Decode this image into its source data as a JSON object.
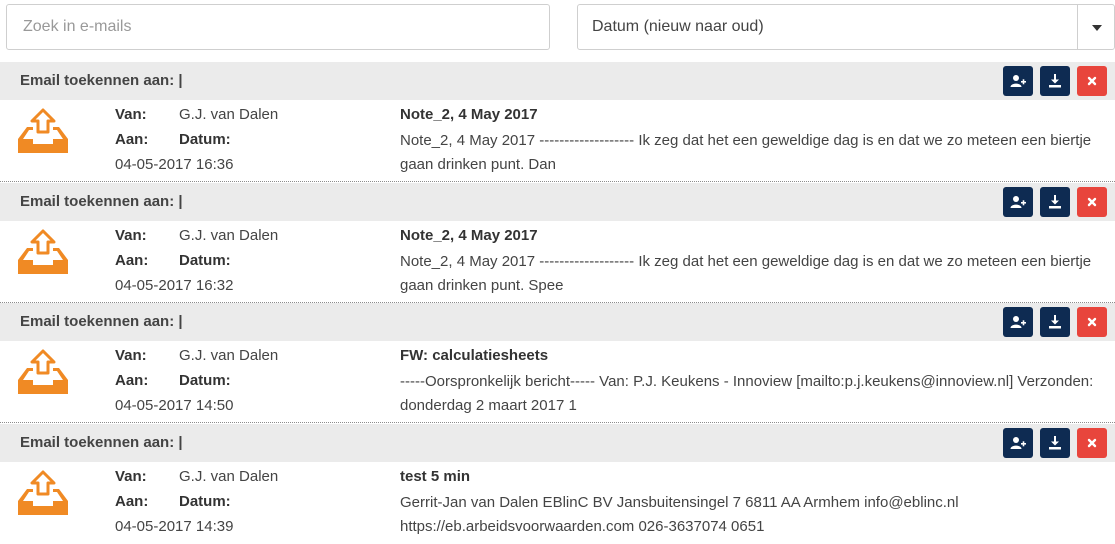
{
  "search": {
    "placeholder": "Zoek in e-mails"
  },
  "sort": {
    "selected": "Datum (nieuw naar oud)"
  },
  "colors": {
    "accent_navy": "#0e2b52",
    "delete_red": "#e8453c",
    "inbox_orange": "#f08a24",
    "assign_bar_bg": "#ebebeb"
  },
  "icons": {
    "assign": "user-plus-icon",
    "download": "download-icon",
    "delete": "close-icon",
    "inbox": "inbox-upload-icon"
  },
  "labels": {
    "assign_to": "Email toekennen aan: |",
    "from": "Van:",
    "to": "Aan:",
    "date": "Datum:"
  },
  "emails": [
    {
      "from": "G.J. van Dalen",
      "datetime": "04-05-2017 16:36",
      "subject": "Note_2, 4 May 2017",
      "preview": "Note_2, 4 May 2017 ------------------- Ik zeg dat het een geweldige dag is en dat we zo meteen een biertje gaan drinken punt. Dan"
    },
    {
      "from": "G.J. van Dalen",
      "datetime": "04-05-2017 16:32",
      "subject": "Note_2, 4 May 2017",
      "preview": "Note_2, 4 May 2017 ------------------- Ik zeg dat het een geweldige dag is en dat we zo meteen een biertje gaan drinken punt. Spee"
    },
    {
      "from": "G.J. van Dalen",
      "datetime": "04-05-2017 14:50",
      "subject": "FW: calculatiesheets",
      "preview": "-----Oorspronkelijk bericht----- Van: P.J. Keukens - Innoview [mailto:p.j.keukens@innoview.nl] Verzonden: donderdag 2 maart 2017 1"
    },
    {
      "from": "G.J. van Dalen",
      "datetime": "04-05-2017 14:39",
      "subject": "test 5 min",
      "preview": "Gerrit-Jan van Dalen EBlinC BV Jansbuitensingel 7 6811 AA Armhem info@eblinc.nl https://eb.arbeidsvoorwaarden.com 026-3637074 0651"
    }
  ]
}
